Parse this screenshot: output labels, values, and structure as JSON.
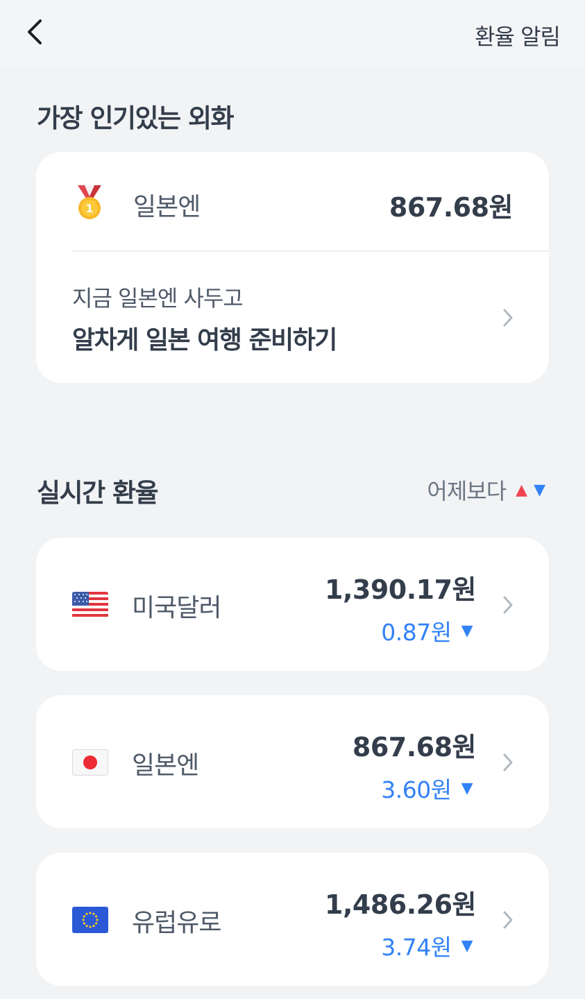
{
  "header": {
    "back_icon": "chevron-left-icon",
    "alert_label": "환율 알림"
  },
  "popular": {
    "title": "가장 인기있는 외화",
    "top_currency": {
      "rank": "1",
      "icon": "gold-medal-icon",
      "name": "일본엔",
      "rate": "867.68원"
    },
    "promo": {
      "sub": "지금 일본엔 사두고",
      "main": "알차게 일본 여행 준비하기"
    }
  },
  "realtime": {
    "title": "실시간 환율",
    "compare_label": "어제보다",
    "up_symbol": "▲",
    "down_symbol": "▼",
    "colors": {
      "up": "#f04452",
      "down": "#3182f6"
    },
    "rows": [
      {
        "name": "미국달러",
        "flag": "us-flag-icon",
        "rate": "1,390.17원",
        "change": "0.87원",
        "direction": "▼"
      },
      {
        "name": "일본엔",
        "flag": "japan-flag-icon",
        "rate": "867.68원",
        "change": "3.60원",
        "direction": "▼"
      },
      {
        "name": "유럽유로",
        "flag": "eu-flag-icon",
        "rate": "1,486.26원",
        "change": "3.74원",
        "direction": "▼"
      }
    ]
  }
}
